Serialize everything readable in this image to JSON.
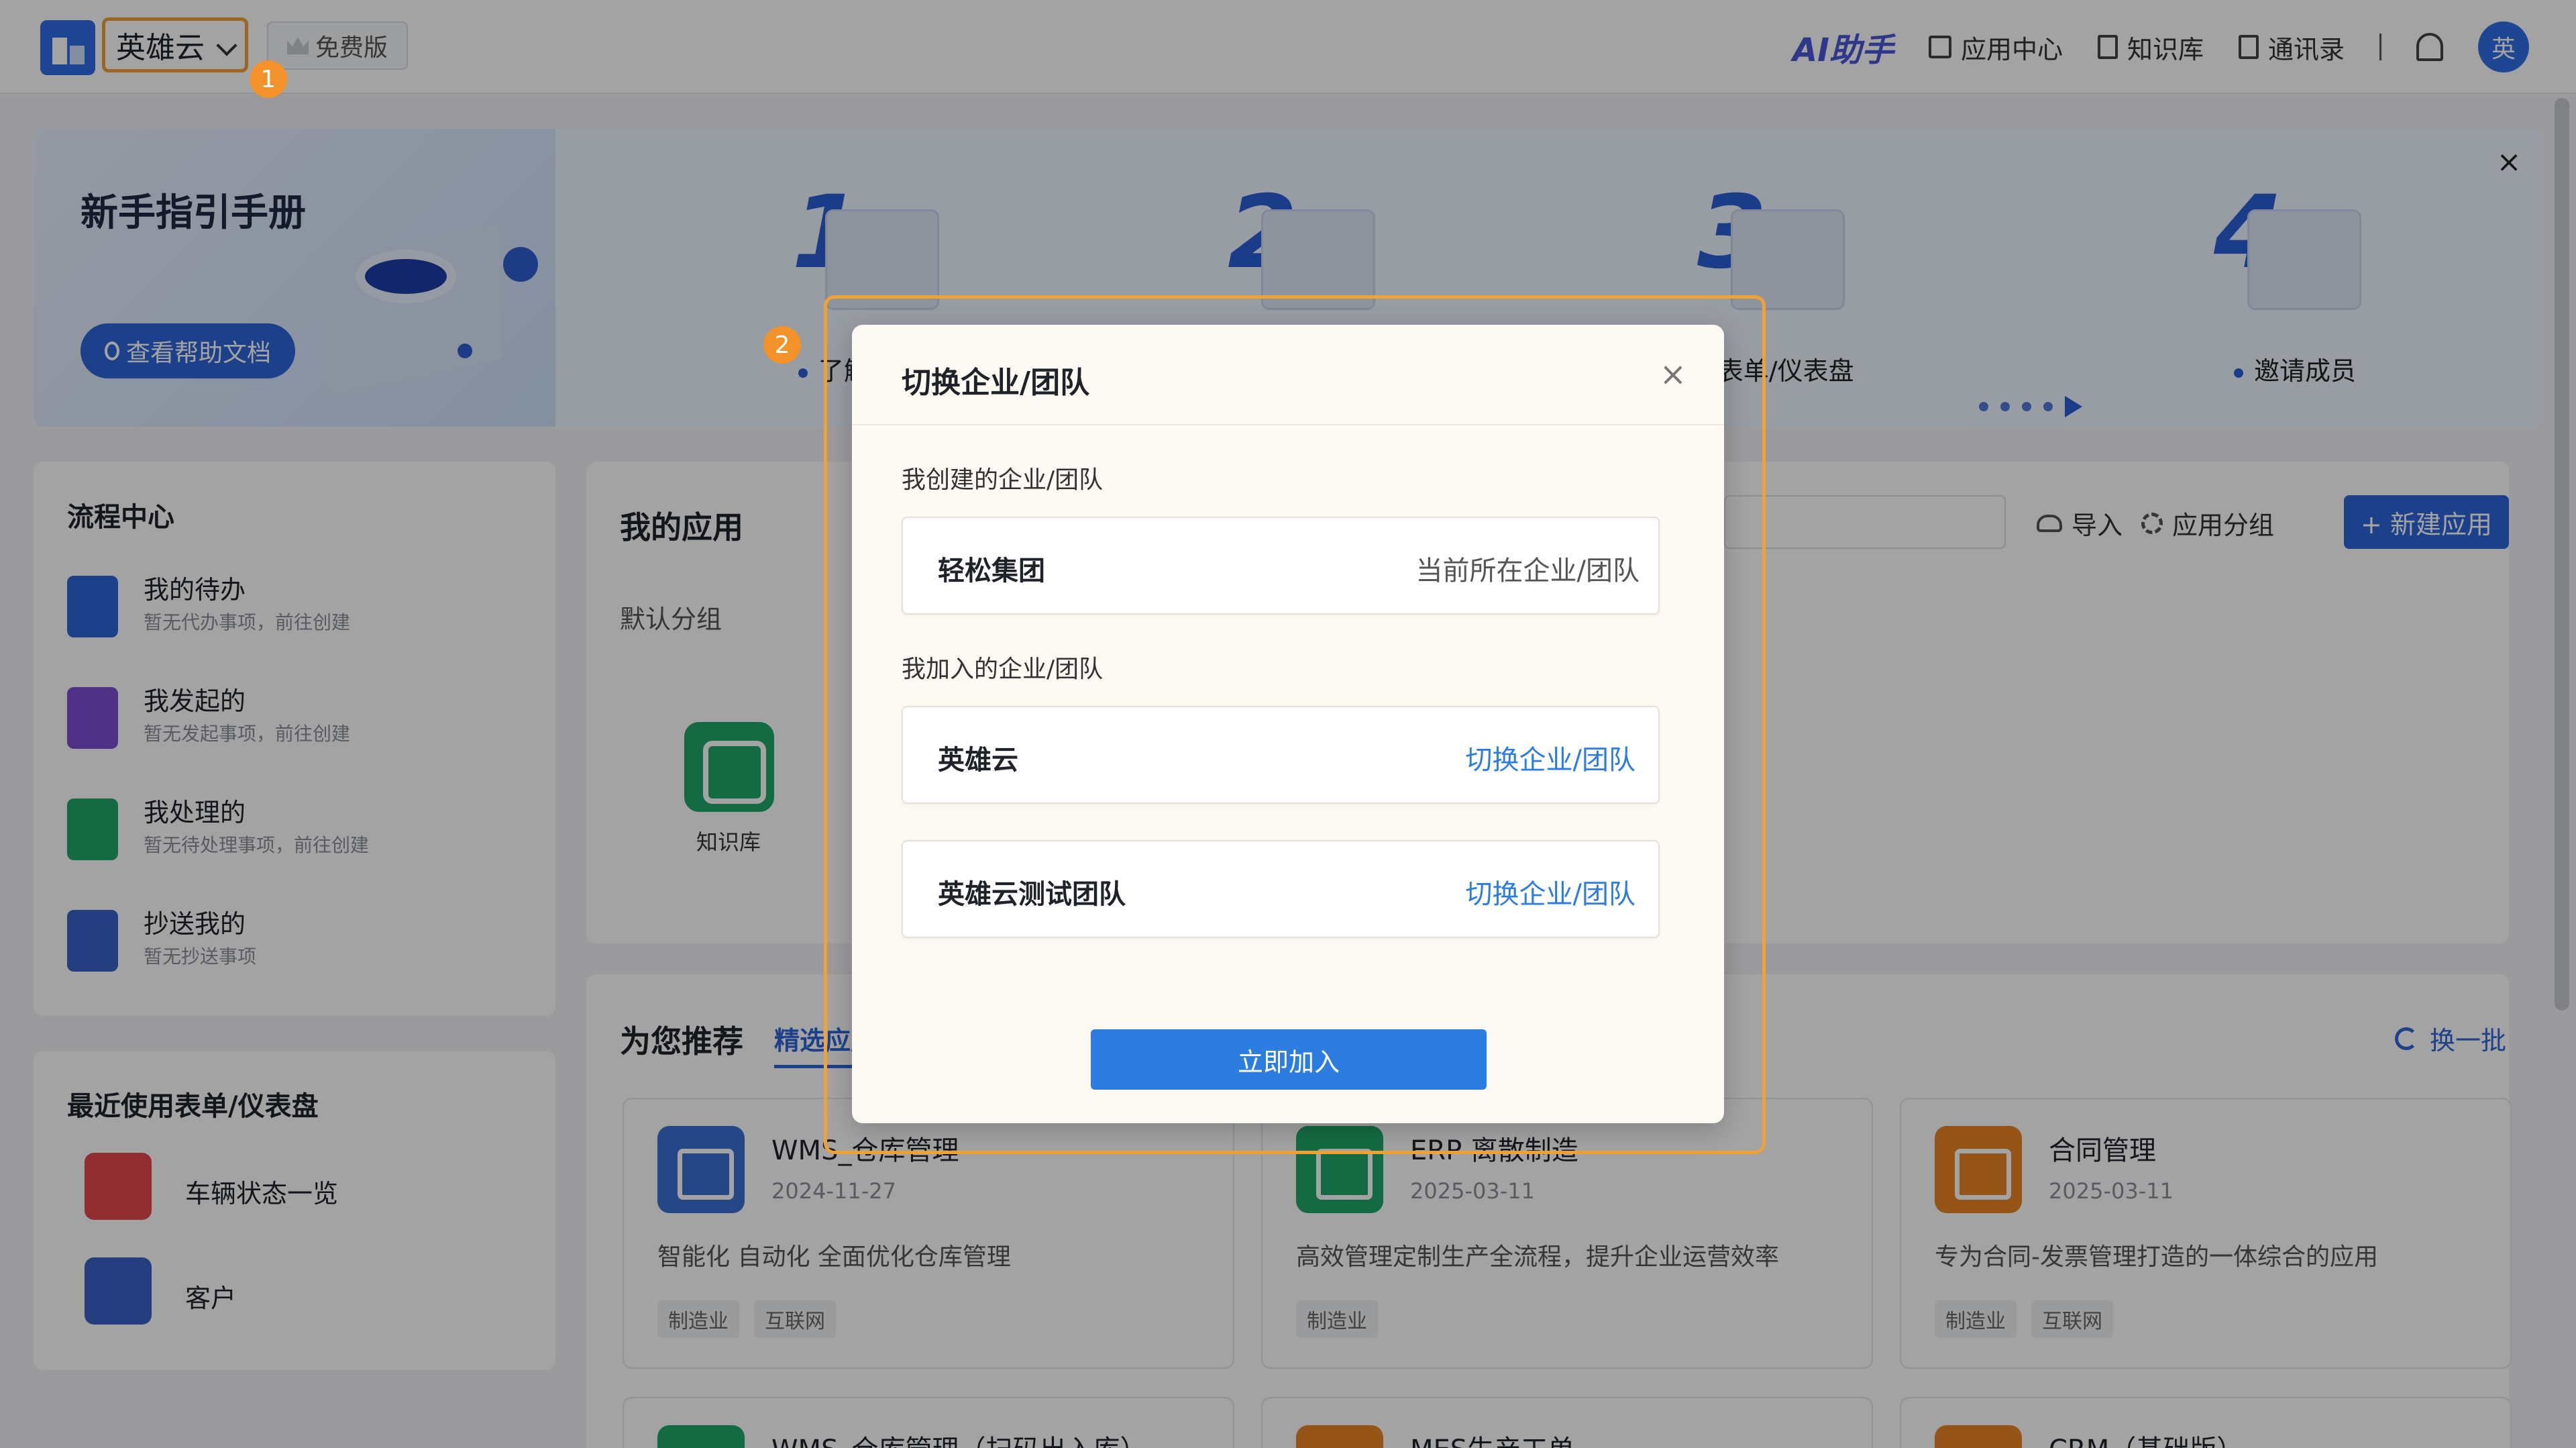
{
  "header": {
    "company_name": "英雄云",
    "plan_label": "免费版",
    "ai_label": "AI助手",
    "nav": [
      {
        "label": "应用中心"
      },
      {
        "label": "知识库"
      },
      {
        "label": "通讯录"
      }
    ],
    "avatar_text": "英"
  },
  "callouts": {
    "one": "1",
    "two": "2"
  },
  "guide": {
    "title": "新手指引手册",
    "help_button": "查看帮助文档",
    "close": "×",
    "steps": [
      {
        "num": "1",
        "label": "了解平台"
      },
      {
        "num": "2",
        "label": ""
      },
      {
        "num": "3",
        "label": "程/表单/仪表盘"
      },
      {
        "num": "4",
        "label": "邀请成员"
      }
    ]
  },
  "flow_center": {
    "title": "流程中心",
    "items": [
      {
        "name": "我的待办",
        "sub": "暂无代办事项，前往创建"
      },
      {
        "name": "我发起的",
        "sub": "暂无发起事项，前往创建"
      },
      {
        "name": "我处理的",
        "sub": "暂无待处理事项，前往创建"
      },
      {
        "name": "抄送我的",
        "sub": "暂无抄送事项"
      }
    ]
  },
  "recent": {
    "title": "最近使用表单/仪表盘",
    "items": [
      {
        "name": "车辆状态一览"
      },
      {
        "name": "客户"
      }
    ]
  },
  "my_apps": {
    "title": "我的应用",
    "group": "默认分组",
    "apps": [
      {
        "name": "知识库"
      }
    ],
    "import_label": "导入",
    "group_label": "应用分组",
    "new_app_label": "+ 新建应用"
  },
  "recommend": {
    "title": "为您推荐",
    "tab": "精选应用",
    "refresh": "换一批",
    "cards": [
      {
        "name": "WMS_仓库管理",
        "date": "2024-11-27",
        "desc": "智能化 自动化 全面优化仓库管理",
        "tags": [
          "制造业",
          "互联网"
        ]
      },
      {
        "name": "ERP-离散制造",
        "date": "2025-03-11",
        "desc": "高效管理定制生产全流程，提升企业运营效率",
        "tags": [
          "制造业"
        ]
      },
      {
        "name": "合同管理",
        "date": "2025-03-11",
        "desc": "专为合同-发票管理打造的一体综合的应用",
        "tags": [
          "制造业",
          "互联网"
        ]
      }
    ],
    "more": [
      {
        "name": "WMS_仓库管理（扫码出入库）"
      },
      {
        "name": "MES生产工单"
      },
      {
        "name": "CRM（基础版）"
      }
    ]
  },
  "modal": {
    "title": "切换企业/团队",
    "close": "×",
    "created_label": "我创建的企业/团队",
    "created": [
      {
        "name": "轻松集团",
        "status": "当前所在企业/团队"
      }
    ],
    "joined_label": "我加入的企业/团队",
    "joined": [
      {
        "name": "英雄云",
        "action": "切换企业/团队"
      },
      {
        "name": "英雄云测试团队",
        "action": "切换企业/团队"
      }
    ],
    "join_button": "立即加入"
  },
  "colors": {
    "accent": "#2d64d8",
    "highlight": "#f0a237",
    "link": "#2d7de0"
  }
}
